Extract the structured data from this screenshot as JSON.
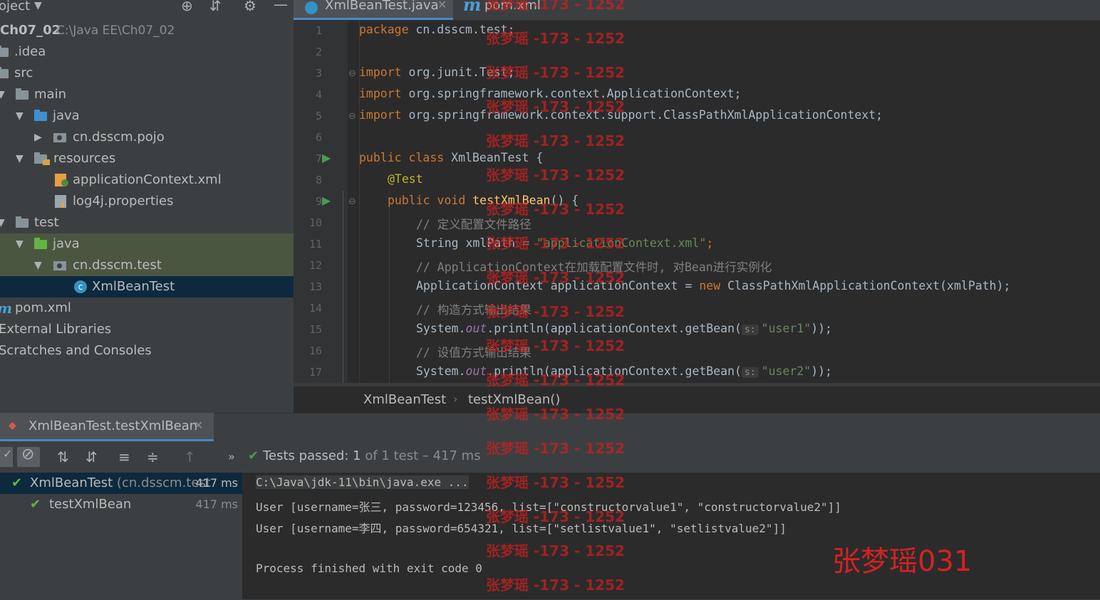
{
  "project_panel": {
    "title": "oject",
    "root_name": "Ch07_02",
    "root_path": "C:\\Java EE\\Ch07_02",
    "nodes": [
      ".idea",
      "src",
      "main",
      "java",
      "cn.dsscm.pojo",
      "resources",
      "applicationContext.xml",
      "log4j.properties",
      "test",
      "java",
      "cn.dsscm.test",
      "XmlBeanTest",
      "pom.xml",
      "External Libraries",
      "Scratches and Consoles"
    ]
  },
  "editor": {
    "tabs": [
      "XmlBeanTest.java",
      "pom.xml"
    ],
    "breadcrumb": [
      "XmlBeanTest",
      "testXmlBean()"
    ],
    "line_numbers": [
      "1",
      "2",
      "3",
      "4",
      "5",
      "6",
      "7",
      "8",
      "9",
      "10",
      "11",
      "12",
      "13",
      "14",
      "15",
      "16",
      "17"
    ],
    "code": {
      "l1_kw": "package",
      "l1_rest": " cn.dsscm.test;",
      "l3_kw": "import",
      "l3_rest": " org.junit.Test;",
      "l4_kw": "import",
      "l4_rest": " org.springframework.context.ApplicationContext;",
      "l5_kw": "import",
      "l5_rest": " org.springframework.context.support.ClassPathXmlApplicationContext;",
      "l7_kw": "public class",
      "l7_rest": " XmlBeanTest {",
      "l8": "@Test",
      "l9_kw": "public void",
      "l9_fn": " testXmlBean",
      "l9_rest": "() {",
      "l10": "// 定义配置文件路径",
      "l11_a": "String xmlPath = ",
      "l11_str": "\"applicationContext.xml\"",
      "l11_b": ";",
      "l12": "// ApplicationContext在加载配置文件时, 对Bean进行实例化",
      "l13_a": "ApplicationContext applicationContext = ",
      "l13_kw": "new",
      "l13_b": " ClassPathXmlApplicationContext(xmlPath);",
      "l14": "// 构造方式输出结果",
      "l15_a": "System.",
      "l15_st": "out",
      "l15_b": ".println(applicationContext.getBean(",
      "l15_ph": "s:",
      "l15_str": "\"user1\"",
      "l15_c": "));",
      "l16": "// 设值方式输出结果",
      "l17_a": "System.",
      "l17_st": "out",
      "l17_b": ".println(applicationContext.getBean(",
      "l17_ph": "s:",
      "l17_str": "\"user2\"",
      "l17_c": "));"
    }
  },
  "run_panel": {
    "tab_title": "XmlBeanTest.testXmlBean",
    "status_prefix": "Tests passed:",
    "status_count": "1",
    "status_rest": "of 1 test – 417 ms",
    "tree": [
      {
        "name": "XmlBeanTest",
        "package": "(cn.dsscm.test",
        "time": "417 ms"
      },
      {
        "name": "testXmlBean",
        "time": "417 ms"
      }
    ],
    "console": [
      "C:\\Java\\jdk-11\\bin\\java.exe ...",
      "User [username=张三, password=123456, list=[\"constructorvalue1\", \"constructorvalue2\"]]",
      "User [username=李四, password=654321, list=[\"setlistvalue1\", \"setlistvalue2\"]]",
      "Process finished with exit code 0"
    ]
  },
  "watermark": {
    "text": "张梦瑶 -173 - 1252",
    "signature": "张梦瑶031",
    "color": "#c72020"
  }
}
